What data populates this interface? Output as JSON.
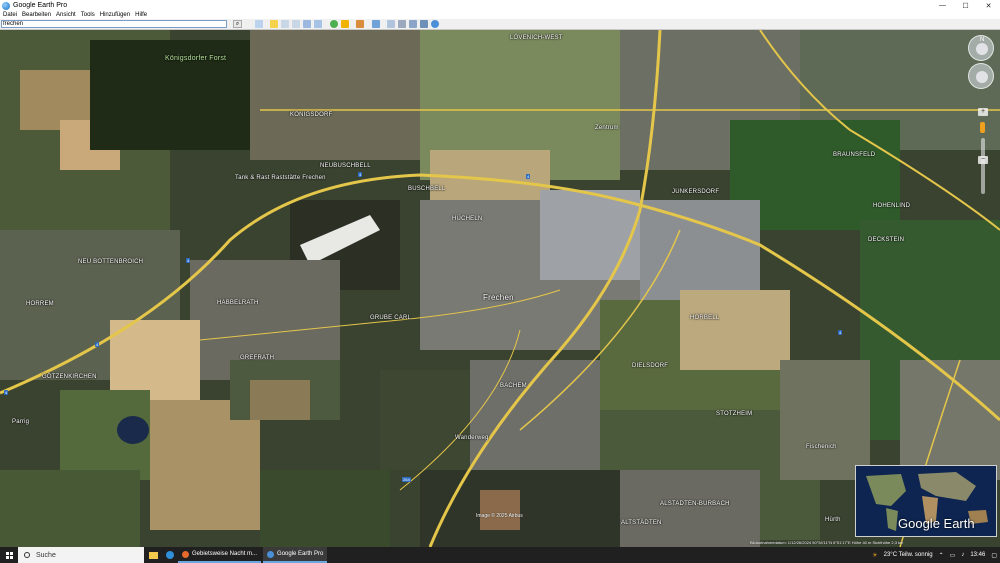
{
  "window": {
    "title": "Google Earth Pro",
    "controls": [
      "minimize-icon",
      "maximize-icon",
      "close-icon"
    ]
  },
  "menu": [
    "Datei",
    "Bearbeiten",
    "Ansicht",
    "Tools",
    "Hinzufügen",
    "Hilfe"
  ],
  "search": {
    "value": "frechen"
  },
  "map": {
    "places": [
      "Königsdorfer Forst",
      "KÖNIGSDORF",
      "NEUBUSCHBELL",
      "Tank & Rast Raststätte Frechen",
      "BUSCHBELL",
      "LÖVENICH-WEST",
      "BRAUNSFELD",
      "JUNKERSDORF",
      "HOHENLIND",
      "DECKSTEIN",
      "NEU BOTTENBROICH",
      "HORREM",
      "HABBELRATH",
      "GREFRATH",
      "GRUBE CARL",
      "Frechen",
      "HÜCHELN",
      "HORBELL",
      "BACHEM",
      "DIELSDORF",
      "GÖTZENKIRCHEN",
      "STOTZHEIM",
      "ALSTADTEN-BURBACH",
      "ALTSTÄDTEN",
      "Hürth",
      "Fischenich",
      "Parrig",
      "Wanderweg",
      "Zentrum"
    ],
    "road_shields": [
      "4",
      "4",
      "4",
      "4",
      "4",
      "4",
      "264"
    ],
    "copyright": "Image © 2025 Airbus",
    "statusline": "Bildaufnahmedatum: 1/12/26/2024   50°54'11\"N   6°51'17\"E   Höhe 40 m   Sichthöhe 2,3 km"
  },
  "overview": {
    "logo": "Google Earth"
  },
  "taskbar": {
    "search_label": "Suche",
    "apps": [
      "Gebietsweise Nacht m...",
      "Google Earth Pro"
    ],
    "weather": "23°C  Teilw. sonnig",
    "time": "13:46"
  }
}
